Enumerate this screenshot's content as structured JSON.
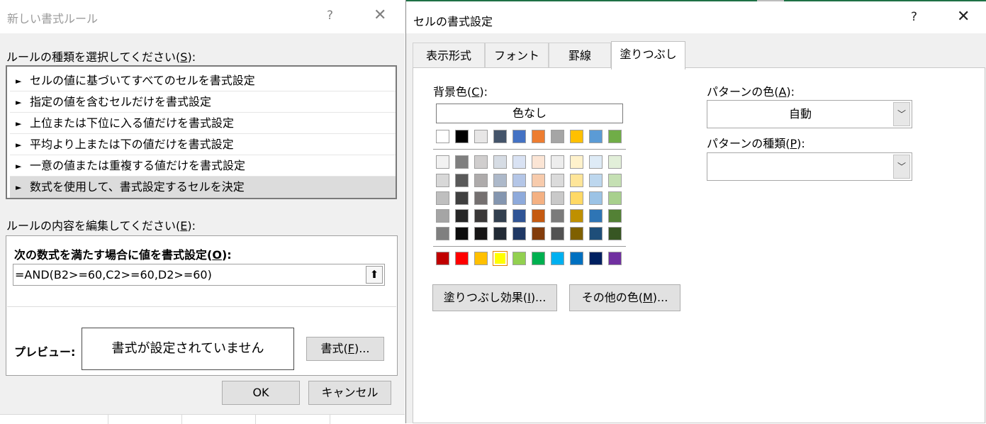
{
  "left_dialog": {
    "title": "新しい書式ルール",
    "help_glyph": "?",
    "close_glyph": "✕",
    "rule_type_label_pre": "ルールの種類を選択してください(",
    "rule_type_label_key": "S",
    "rule_type_label_post": "):",
    "rule_types": [
      "セルの値に基づいてすべてのセルを書式設定",
      "指定の値を含むセルだけを書式設定",
      "上位または下位に入る値だけを書式設定",
      "平均より上または下の値だけを書式設定",
      "一意の値または重複する値だけを書式設定",
      "数式を使用して、書式設定するセルを決定"
    ],
    "selected_rule_index": 5,
    "edit_label_pre": "ルールの内容を編集してください(",
    "edit_label_key": "E",
    "edit_label_post": "):",
    "formula_label_pre": "次の数式を満たす場合に値を書式設定(",
    "formula_label_key": "O",
    "formula_label_post": "):",
    "formula_value": "=AND(B2>=60,C2>=60,D2>=60)",
    "preview_label": "プレビュー:",
    "preview_text": "書式が設定されていません",
    "format_button_pre": "書式(",
    "format_button_key": "F",
    "format_button_post": ")...",
    "ok_button": "OK",
    "cancel_button": "キャンセル"
  },
  "right_dialog": {
    "title": "セルの書式設定",
    "help_glyph": "?",
    "close_glyph": "✕",
    "tabs": [
      "表示形式",
      "フォント",
      "罫線",
      "塗りつぶし"
    ],
    "active_tab": "塗りつぶし",
    "bg_color_label_pre": "背景色(",
    "bg_color_label_key": "C",
    "bg_color_label_post": "):",
    "no_color_button": "色なし",
    "palette": {
      "theme_row": [
        "#ffffff",
        "#000000",
        "#e7e6e6",
        "#44546a",
        "#4472c4",
        "#ed7d31",
        "#a5a5a5",
        "#ffc000",
        "#5b9bd5",
        "#70ad47"
      ],
      "tint_rows": [
        [
          "#f2f2f2",
          "#7f7f7f",
          "#d0cece",
          "#d6dce4",
          "#d9e2f3",
          "#fbe5d5",
          "#ededed",
          "#fff2cc",
          "#deebf6",
          "#e2efd9"
        ],
        [
          "#d8d8d8",
          "#595959",
          "#aeabab",
          "#adb9ca",
          "#b4c6e7",
          "#f7cbac",
          "#dbdbdb",
          "#fee599",
          "#bdd7ee",
          "#c5e0b3"
        ],
        [
          "#bfbfbf",
          "#3f3f3f",
          "#757070",
          "#8496b0",
          "#8eaadb",
          "#f4b183",
          "#c9c9c9",
          "#ffd965",
          "#9cc3e5",
          "#a8d08d"
        ],
        [
          "#a5a5a5",
          "#262626",
          "#3a3838",
          "#323f4f",
          "#2f5496",
          "#c55a11",
          "#7b7b7b",
          "#bf9000",
          "#2e75b5",
          "#538135"
        ],
        [
          "#7f7f7f",
          "#0c0c0c",
          "#171616",
          "#222a35",
          "#1f3864",
          "#833c0b",
          "#525252",
          "#7f6000",
          "#1e4e79",
          "#375623"
        ]
      ],
      "standard_row": [
        "#c00000",
        "#ff0000",
        "#ffc000",
        "#ffff00",
        "#92d050",
        "#00b050",
        "#00b0f0",
        "#0070c0",
        "#002060",
        "#7030a0"
      ]
    },
    "fill_effects_pre": "塗りつぶし効果(",
    "fill_effects_key": "I",
    "fill_effects_post": ")...",
    "more_colors_pre": "その他の色(",
    "more_colors_key": "M",
    "more_colors_post": ")...",
    "pattern_color_label_pre": "パターンの色(",
    "pattern_color_label_key": "A",
    "pattern_color_label_post": "):",
    "pattern_color_value": "自動",
    "pattern_style_label_pre": "パターンの種類(",
    "pattern_style_label_key": "P",
    "pattern_style_label_post": "):",
    "pattern_style_value": "",
    "dropdown_glyph": "﹀"
  }
}
